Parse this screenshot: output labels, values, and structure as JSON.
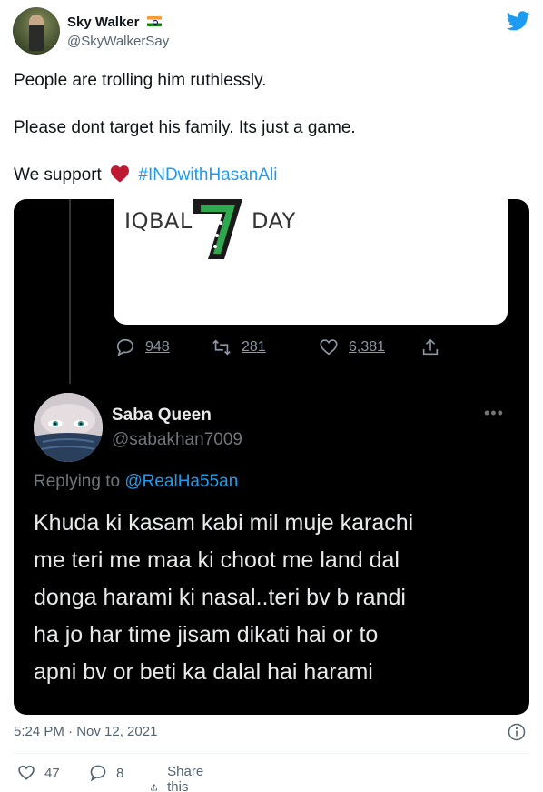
{
  "author": {
    "display_name": "Sky Walker",
    "handle": "@SkyWalkerSay",
    "flag_icon": "india-flag-icon"
  },
  "tweet": {
    "line1": "People are trolling him ruthlessly.",
    "line2": "Please dont target his family. Its just a game.",
    "line3_prefix": "We support",
    "hashtag": "#INDwithHasanAli"
  },
  "media": {
    "quoted_card": {
      "left_word": "IQBAL",
      "right_word": "DAY"
    },
    "actions": {
      "replies": "948",
      "retweets": "281",
      "likes": "6,381"
    },
    "reply": {
      "name": "Saba Queen",
      "handle": "@sabakhan7009",
      "replying_prefix": "Replying to",
      "replying_mention": "@RealHa55an",
      "body": "Khuda ki kasam kabi mil muje karachi\nme teri  me maa ki choot me land dal\ndonga harami ki nasal..teri bv b randi\nha jo har time jisam dikati hai or to\napni bv or beti ka dalal hai harami"
    }
  },
  "meta": {
    "timestamp": "5:24 PM · Nov 12, 2021"
  },
  "footer": {
    "likes": "47",
    "replies": "8",
    "share_label": "Share this Tweet"
  },
  "colors": {
    "accent": "#1d9bf0",
    "heart": "#e0245e",
    "muted": "#536471"
  }
}
